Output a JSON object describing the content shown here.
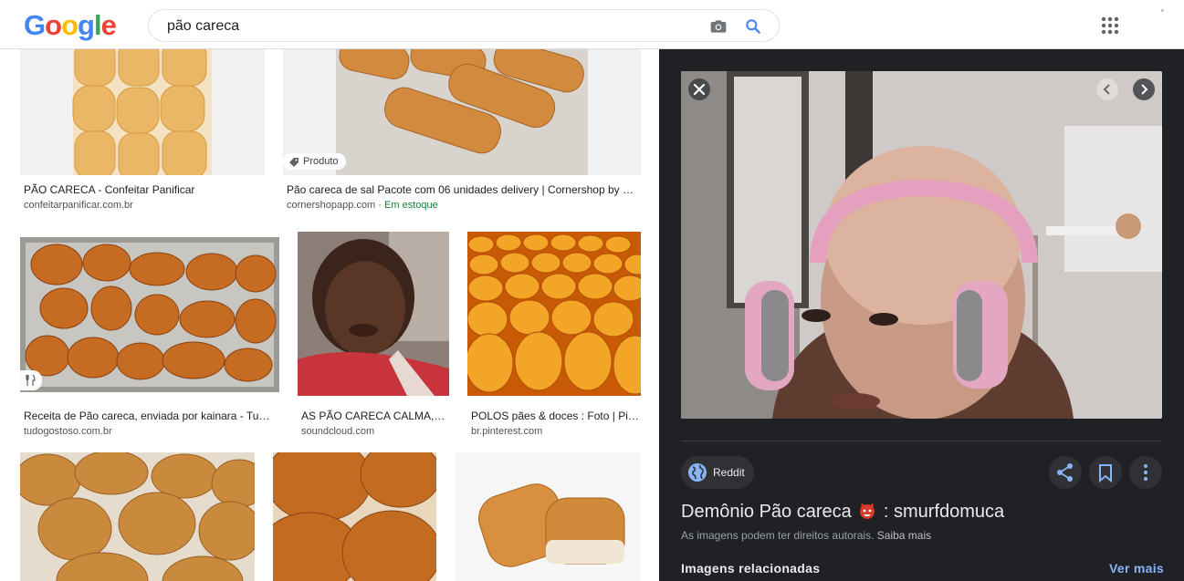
{
  "header": {
    "logo_letters": [
      "G",
      "o",
      "o",
      "g",
      "l",
      "e"
    ],
    "logo_colors": [
      "#4285f4",
      "#ea4335",
      "#fbbc05",
      "#4285f4",
      "#34a853",
      "#ea4335"
    ],
    "search_value": "pão careca",
    "icons": [
      "camera-icon",
      "search-icon",
      "apps-grid-icon"
    ]
  },
  "results": [
    {
      "title": "PÃO CARECA - Confeitar Panificar",
      "source": "confeitarpanificar.com.br"
    },
    {
      "title": "Pão careca de sal Pacote com 06 unidades delivery | Cornershop by Uber",
      "source": "cornershopapp.com",
      "badge": "Produto",
      "stock": "Em estoque"
    },
    {
      "title": "Receita de Pão careca, enviada por kainara - TudoGostoso",
      "source": "tudogostoso.com.br",
      "icon": "fork-knife-icon"
    },
    {
      "title": "AS PÃO CARECA CALMA, SOCORRO",
      "source": "soundcloud.com"
    },
    {
      "title": "POLOS pães & doces : Foto | Pinterest",
      "source": "br.pinterest.com"
    },
    {
      "title": "",
      "source": ""
    },
    {
      "title": "",
      "source": ""
    },
    {
      "title": "",
      "source": ""
    }
  ],
  "panel": {
    "source_name": "Reddit",
    "title_part1": "Demônio Pão careca",
    "title_part2": ": smurfdomuca",
    "rights_text": "As imagens podem ter direitos autorais.",
    "rights_link": "Saiba mais",
    "related_label": "Imagens relacionadas",
    "more_label": "Ver mais"
  },
  "colors": {
    "panel_bg": "#202124",
    "link_blue": "#8ab4f8",
    "stock_green": "#188038"
  }
}
